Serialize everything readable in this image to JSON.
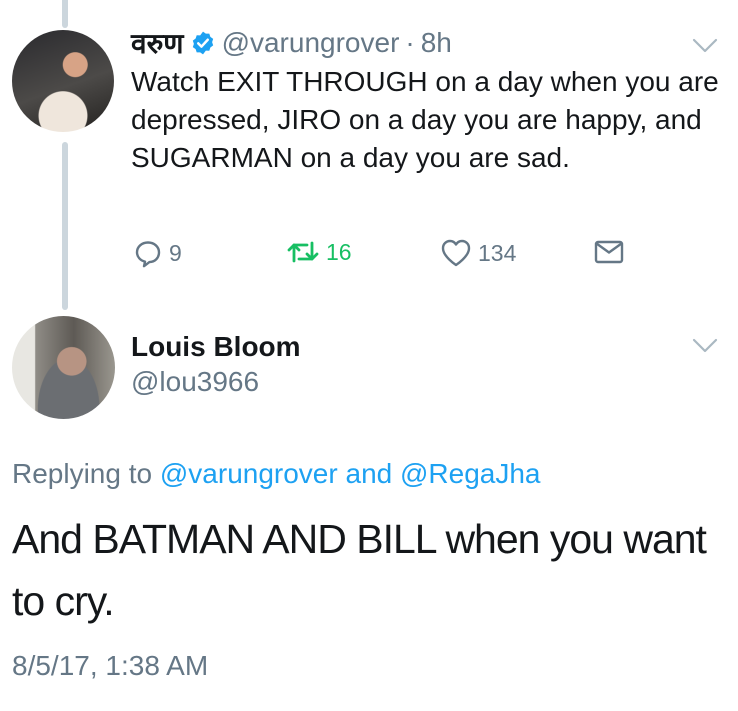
{
  "tweet": {
    "author_name": "वरुण",
    "handle": "@varungrover",
    "separator": "·",
    "time_ago": "8h",
    "text": "Watch EXIT THROUGH on a day when you are depressed, JIRO on a day you are happy, and SUGARMAN on a day you are sad.",
    "actions": {
      "reply_count": "9",
      "retweet_count": "16",
      "like_count": "134"
    }
  },
  "reply": {
    "author_name": "Louis Bloom",
    "handle": "@lou3966",
    "replying_prefix": "Replying to",
    "replying_user1": "@varungrover",
    "replying_and": "and",
    "replying_user2": "@RegaJha",
    "text": "And BATMAN AND BILL when you want to cry.",
    "timestamp": "8/5/17, 1:38 AM"
  },
  "colors": {
    "link": "#1da1f2",
    "retweet": "#17bf63",
    "secondary_text": "#657786",
    "thread_line": "#ccd6dd"
  },
  "icons": [
    "verified-badge-icon",
    "chevron-down-icon",
    "reply-icon",
    "retweet-icon",
    "like-heart-icon",
    "direct-message-icon"
  ]
}
